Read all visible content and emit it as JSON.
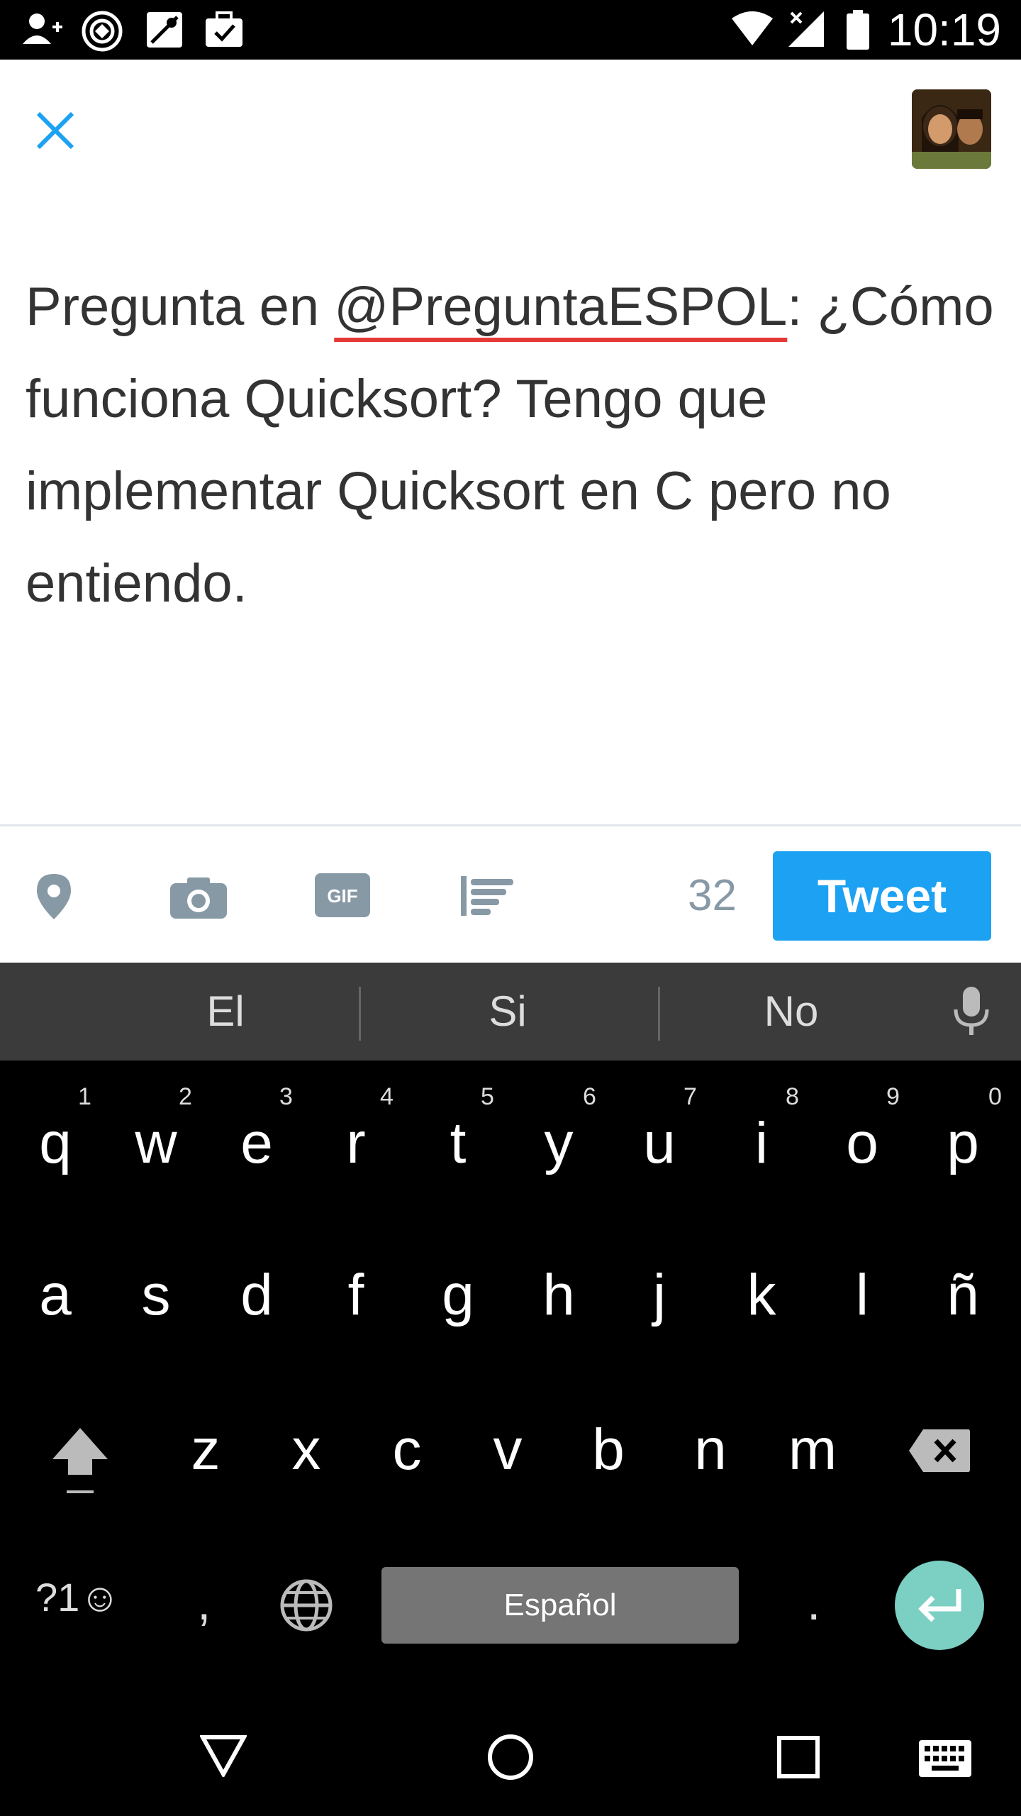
{
  "status_bar": {
    "time": "10:19"
  },
  "compose": {
    "text_prefix": "Pregunta en ",
    "mention": "@PreguntaESPOL",
    "text_suffix": ": ¿Cómo funciona Quicksort? Tengo que implementar Quicksort en C pero no entiendo."
  },
  "toolbar": {
    "char_count": "32",
    "tweet_label": "Tweet"
  },
  "keyboard": {
    "suggestions": [
      "El",
      "Si",
      "No"
    ],
    "row1": [
      "q",
      "w",
      "e",
      "r",
      "t",
      "y",
      "u",
      "i",
      "o",
      "p"
    ],
    "row1_hints": [
      "1",
      "2",
      "3",
      "4",
      "5",
      "6",
      "7",
      "8",
      "9",
      "0"
    ],
    "row2": [
      "a",
      "s",
      "d",
      "f",
      "g",
      "h",
      "j",
      "k",
      "l",
      "ñ"
    ],
    "row3": [
      "z",
      "x",
      "c",
      "v",
      "b",
      "n",
      "m"
    ],
    "symbols_label": "?1☺",
    "comma": ",",
    "space_label": "Español",
    "period": "."
  }
}
